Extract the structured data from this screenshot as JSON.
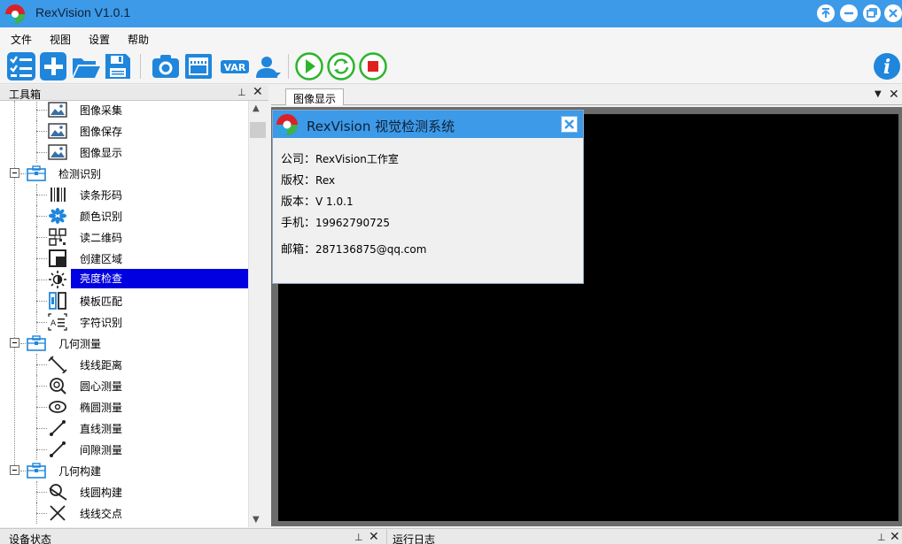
{
  "app": {
    "title": "RexVision V1.0.1"
  },
  "menu": [
    "文件",
    "视图",
    "设置",
    "帮助"
  ],
  "toolbar": {
    "icons": [
      "list-check-icon",
      "plus-icon",
      "folder-open-icon",
      "save-icon",
      "camera-icon",
      "film-icon",
      "var-icon",
      "user-icon",
      "play-icon",
      "refresh-icon",
      "stop-icon",
      "info-icon"
    ],
    "var_label": "VAR",
    "info_label": "i"
  },
  "toolbox": {
    "title": "工具箱",
    "pin": "⊥",
    "items": [
      {
        "label": "图像采集",
        "icon": "image-acquire-icon"
      },
      {
        "label": "图像保存",
        "icon": "image-save-icon"
      },
      {
        "label": "图像显示",
        "icon": "image-display-icon"
      },
      {
        "label": "检测识别",
        "icon": "toolbox-icon",
        "group": true
      },
      {
        "label": "读条形码",
        "icon": "barcode-icon"
      },
      {
        "label": "颜色识别",
        "icon": "color-icon"
      },
      {
        "label": "读二维码",
        "icon": "qrcode-icon"
      },
      {
        "label": "创建区域",
        "icon": "region-icon"
      },
      {
        "label": "亮度检查",
        "icon": "brightness-icon",
        "selected": true
      },
      {
        "label": "模板匹配",
        "icon": "template-icon"
      },
      {
        "label": "字符识别",
        "icon": "ocr-icon"
      },
      {
        "label": "几何测量",
        "icon": "toolbox-icon",
        "group": true
      },
      {
        "label": "线线距离",
        "icon": "line-distance-icon"
      },
      {
        "label": "圆心测量",
        "icon": "circle-center-icon"
      },
      {
        "label": "椭圆测量",
        "icon": "ellipse-icon"
      },
      {
        "label": "直线测量",
        "icon": "line-measure-icon"
      },
      {
        "label": "间隙测量",
        "icon": "gap-icon"
      },
      {
        "label": "几何构建",
        "icon": "toolbox-icon",
        "group": true
      },
      {
        "label": "线圆构建",
        "icon": "line-circle-icon"
      },
      {
        "label": "线线交点",
        "icon": "intersection-icon"
      }
    ]
  },
  "view": {
    "tab_label": "图像显示"
  },
  "about": {
    "title": "RexVision 视觉检测系统",
    "lines": [
      {
        "key": "公司：",
        "value": "RexVision工作室"
      },
      {
        "key": "版权：",
        "value": "Rex"
      },
      {
        "key": "版本：",
        "value": "V 1.0.1"
      },
      {
        "key": "手机：",
        "value": "19962790725"
      },
      {
        "key": "邮箱：",
        "value": "287136875@qq.com"
      }
    ]
  },
  "bottom": {
    "left_title": "设备状态",
    "right_title": "运行日志"
  },
  "colors": {
    "titlebar": "#3d9ae8",
    "toolbar_icon": "#1f86dc",
    "selection": "#0000e0",
    "play": "#2bb52b",
    "stop": "#e02020"
  }
}
